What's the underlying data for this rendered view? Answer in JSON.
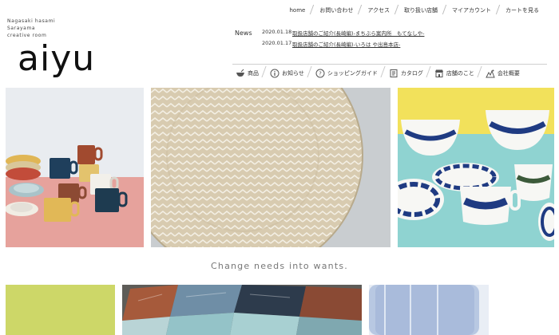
{
  "brand": {
    "tagline_lines": [
      "Nagasaki hasami",
      "Sarayama",
      "creative room"
    ],
    "logo_text": "aiyu"
  },
  "top_nav": [
    "home",
    "お問い合わせ",
    "アクセス",
    "取り扱い店舗",
    "マイアカウント",
    "カートを見る"
  ],
  "news": {
    "label": "News",
    "items": [
      {
        "date": "2020.01.18",
        "title": "取扱店舗のご紹介(長崎編)-まちぶら案内所　もてなしや-"
      },
      {
        "date": "2020.01.17",
        "title": "取扱店舗のご紹介(長崎編)-いろは や出島本店-"
      }
    ]
  },
  "main_nav": [
    {
      "label": "商品",
      "icon": "bowl-icon"
    },
    {
      "label": "お知らせ",
      "icon": "info-icon"
    },
    {
      "label": "ショッピングガイド",
      "icon": "question-icon"
    },
    {
      "label": "カタログ",
      "icon": "catalog-icon"
    },
    {
      "label": "店舗のこと",
      "icon": "store-icon"
    },
    {
      "label": "会社概要",
      "icon": "company-icon"
    }
  ],
  "tagline": "Change needs into wants.",
  "colors": {
    "accent": "#333333",
    "photo_pink": "#e8a09a",
    "photo_yellow": "#f2e15b",
    "photo_teal": "#8fd3d1",
    "photo_green": "#c7d35c"
  }
}
